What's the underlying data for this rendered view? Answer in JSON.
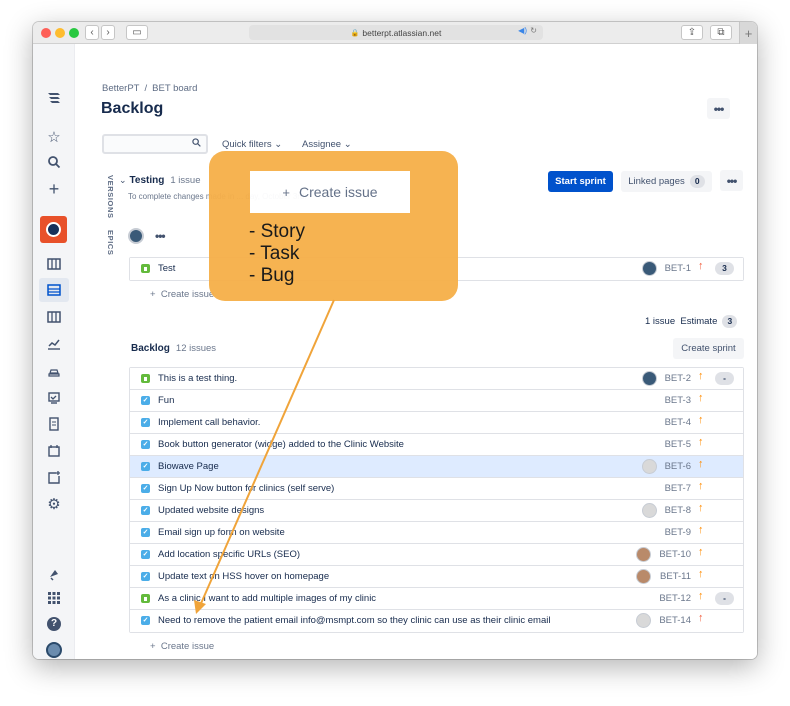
{
  "browser": {
    "url": "betterpt.atlassian.net",
    "back_icon": "chevron-left-icon",
    "forward_icon": "chevron-right-icon",
    "sidebar_icon": "sidebar-icon",
    "share_icon": "share-icon",
    "tabs_icon": "tabs-icon",
    "new_tab": "+"
  },
  "breadcrumbs": {
    "project": "BetterPT",
    "separator": "/",
    "board": "BET board"
  },
  "page": {
    "title": "Backlog",
    "more": "•••"
  },
  "filters": {
    "quick": "Quick filters",
    "assignee": "Assignee"
  },
  "side_tabs": {
    "versions": "VERSIONS",
    "epics": "EPICS"
  },
  "sprint": {
    "name": "Testing",
    "count": "1 issue",
    "note": "To complete changes made in ... day, October 3rd.",
    "start_button": "Start sprint",
    "linked_pages": "Linked pages",
    "linked_count": "0",
    "more": "•••",
    "issues": [
      {
        "type": "story",
        "summary": "Test",
        "key": "BET-1",
        "priority": "high",
        "estimate": "3",
        "avatar": "a"
      }
    ],
    "create_issue": "Create issue",
    "summary_count": "1 issue",
    "summary_estimate_label": "Estimate",
    "summary_estimate": "3"
  },
  "backlog": {
    "name": "Backlog",
    "count": "12 issues",
    "create_sprint": "Create sprint",
    "create_issue": "Create issue",
    "issues": [
      {
        "type": "story",
        "summary": "This is a test thing.",
        "key": "BET-2",
        "priority": "medium",
        "estimate": "-",
        "avatar": "a"
      },
      {
        "type": "task",
        "summary": "Fun",
        "key": "BET-3",
        "priority": "medium",
        "estimate": "",
        "avatar": ""
      },
      {
        "type": "task",
        "summary": "Implement call behavior.",
        "key": "BET-4",
        "priority": "medium",
        "estimate": "",
        "avatar": ""
      },
      {
        "type": "task",
        "summary": "Book button generator (widge) added to the Clinic Website",
        "key": "BET-5",
        "priority": "medium",
        "estimate": "",
        "avatar": ""
      },
      {
        "type": "task",
        "summary": "Biowave Page",
        "key": "BET-6",
        "priority": "medium",
        "estimate": "",
        "avatar": "b",
        "selected": true
      },
      {
        "type": "task",
        "summary": "Sign Up Now button for clinics (self serve)",
        "key": "BET-7",
        "priority": "medium",
        "estimate": "",
        "avatar": ""
      },
      {
        "type": "task",
        "summary": "Updated website designs",
        "key": "BET-8",
        "priority": "medium",
        "estimate": "",
        "avatar": "b"
      },
      {
        "type": "task",
        "summary": "Email sign up form on website",
        "key": "BET-9",
        "priority": "medium",
        "estimate": "",
        "avatar": ""
      },
      {
        "type": "task",
        "summary": "Add location specific URLs (SEO)",
        "key": "BET-10",
        "priority": "medium",
        "estimate": "",
        "avatar": "c"
      },
      {
        "type": "task",
        "summary": "Update text on HSS hover on homepage",
        "key": "BET-11",
        "priority": "medium",
        "estimate": "",
        "avatar": "c"
      },
      {
        "type": "story",
        "summary": "As a clinic I want to add multiple images of my clinic",
        "key": "BET-12",
        "priority": "medium",
        "estimate": "-",
        "avatar": ""
      },
      {
        "type": "task",
        "summary": "Need to remove the patient email info@msmpt.com so they clinic can use as their clinic email",
        "key": "BET-14",
        "priority": "high",
        "estimate": "",
        "avatar": "b"
      }
    ]
  },
  "annotation": {
    "button_label": "Create issue",
    "items": [
      "- Story",
      "- Task",
      "- Bug"
    ],
    "color": "#f6b04a"
  },
  "colors": {
    "primary": "#0052cc",
    "selected_row": "#deebff",
    "project": "#e8512a"
  }
}
